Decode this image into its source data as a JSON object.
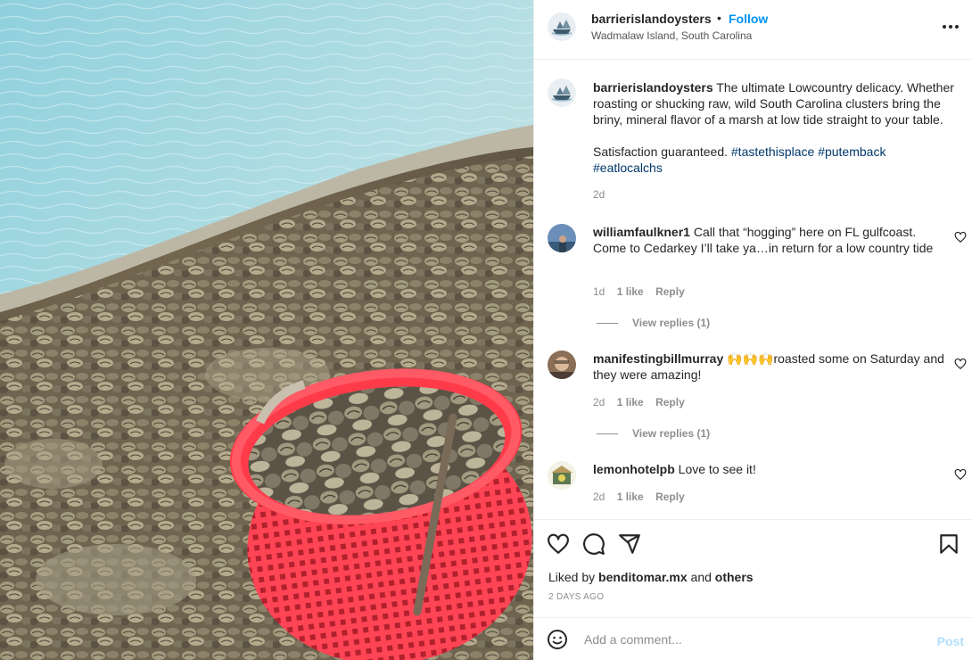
{
  "post": {
    "username": "barrierislandoysters",
    "follow_label": "Follow",
    "separator": "•",
    "location": "Wadmalaw Island, South Carolina",
    "more_icon": "more-horizontal-icon"
  },
  "caption": {
    "username": "barrierislandoysters",
    "text": "The ultimate Lowcountry delicacy. Whether roasting or shucking raw, wild South Carolina clusters bring the briny, mineral flavor of a marsh at low tide straight to your table.",
    "text2": "Satisfaction guaranteed.",
    "hashtags": [
      "#tastethisplace",
      "#putemback",
      "#eatlocalchs"
    ],
    "time": "2d"
  },
  "comments": [
    {
      "username": "williamfaulkner1",
      "text": "Call that “hogging” here on FL gulfcoast. Come to Cedarkey I’ll take ya…in return for a low country tide",
      "time": "1d",
      "likes": "1 like",
      "reply_label": "Reply",
      "view_replies": "View replies (1)"
    },
    {
      "username": "manifestingbillmurray",
      "emoji": "🙌🙌🙌",
      "text": "roasted some on Saturday and they were amazing!",
      "time": "2d",
      "likes": "1 like",
      "reply_label": "Reply",
      "view_replies": "View replies (1)"
    },
    {
      "username": "lemonhotelpb",
      "text": "Love to see it!",
      "time": "2d",
      "likes": "1 like",
      "reply_label": "Reply"
    }
  ],
  "actions": {
    "icons": [
      "heart-icon",
      "comment-icon",
      "share-icon",
      "bookmark-icon"
    ],
    "liked_by_prefix": "Liked by",
    "liked_by_user": "benditomar.mx",
    "liked_by_and": "and",
    "liked_by_others": "others",
    "posted_ago": "2 DAYS AGO"
  },
  "add_comment": {
    "placeholder": "Add a comment...",
    "post_label": "Post",
    "emoji_icon": "smiley-icon"
  },
  "colors": {
    "link": "#0095f6",
    "hashtag": "#00376b",
    "muted": "#8e8e8e",
    "post_disabled": "#b2dffc",
    "basket": "#ff3b4a"
  }
}
